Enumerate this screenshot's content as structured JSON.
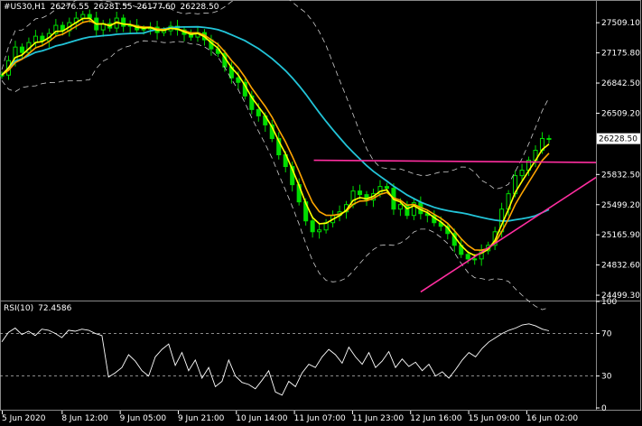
{
  "header": {
    "symbol": "#US30,H1",
    "open": "26276.55",
    "high": "26281.55",
    "low": "26177.60",
    "close": "26228.50"
  },
  "rsi_header": {
    "label": "RSI(10)",
    "value": "72.4586"
  },
  "current_price_label": "26228.50",
  "colors": {
    "background": "#000000",
    "candle": "#00dd00",
    "ema_fast": "#ffff00",
    "ema_slow": "#ffa500",
    "ma_long": "#22c4d8",
    "bands": "#cccccc",
    "trendline": "#ff2ea0",
    "rsi_line": "#ffffff",
    "axis": "#ffffff"
  },
  "chart_data": [
    {
      "type": "line",
      "title": "",
      "xlabel": "",
      "ylabel": "",
      "x_tick_labels": [
        "5 Jun 2020",
        "8 Jun 12:00",
        "9 Jun 05:00",
        "9 Jun 21:00",
        "10 Jun 14:00",
        "11 Jun 07:00",
        "11 Jun 23:00",
        "12 Jun 16:00",
        "15 Jun 09:00",
        "16 Jun 02:00"
      ],
      "y_tick_labels": [
        "27509.10",
        "27175.80",
        "26842.50",
        "26509.20",
        "25832.50",
        "25499.20",
        "25165.90",
        "24832.60",
        "24499.30"
      ],
      "ylim": [
        24450,
        27720
      ],
      "x_count": 140,
      "series": [
        {
          "kind": "price_close",
          "values": [
            26930,
            27090,
            27240,
            27180,
            27290,
            27360,
            27310,
            27390,
            27480,
            27420,
            27510,
            27560,
            27600,
            27560,
            27430,
            27500,
            27450,
            27560,
            27470,
            27480,
            27430,
            27440,
            27460,
            27400,
            27420,
            27470,
            27430,
            27380,
            27350,
            27400,
            27320,
            27220,
            27170,
            27020,
            26900,
            26850,
            26700,
            26550,
            26480,
            26380,
            26230,
            26050,
            25920,
            25720,
            25530,
            25320,
            25200,
            25220,
            25300,
            25380,
            25420,
            25500,
            25650,
            25610,
            25550,
            25620,
            25700,
            25680,
            25450,
            25500,
            25380,
            25520,
            25400,
            25380,
            25300,
            25260,
            25180,
            25050,
            24950,
            24900,
            24900,
            24990,
            25050,
            25200,
            25450,
            25620,
            25820,
            25880,
            25990,
            26100,
            26230,
            26228.5
          ],
          "x_offset": 0
        }
      ],
      "bands_visible": true,
      "grid": false,
      "trendlines": [
        {
          "name": "horizontal resistance",
          "from": {
            "x": 73,
            "y": 25990
          },
          "to": {
            "x": 139,
            "y": 25965
          }
        },
        {
          "name": "rising support",
          "from": {
            "x": 98,
            "y": 24535
          },
          "to": {
            "x": 139,
            "y": 25800
          }
        }
      ]
    },
    {
      "type": "line",
      "title": "",
      "ylabel": "",
      "ylim": [
        0,
        100
      ],
      "y_tick_labels": [
        "100",
        "70",
        "30",
        "0"
      ],
      "levels": [
        70,
        30
      ],
      "series": [
        {
          "name": "RSI(10)",
          "values": [
            62,
            71,
            75,
            69,
            72,
            68,
            74,
            73,
            70,
            66,
            73,
            72,
            74,
            73,
            70,
            68,
            29,
            33,
            38,
            50,
            44,
            35,
            30,
            48,
            55,
            60,
            40,
            52,
            35,
            45,
            28,
            38,
            20,
            25,
            45,
            30,
            24,
            22,
            18,
            26,
            35,
            15,
            12,
            25,
            20,
            33,
            41,
            38,
            48,
            55,
            50,
            42,
            57,
            48,
            41,
            52,
            38,
            44,
            53,
            38,
            46,
            39,
            43,
            35,
            41,
            30,
            34,
            28,
            36,
            45,
            52,
            48,
            56,
            62,
            66,
            70,
            73,
            75,
            78,
            79,
            77,
            74,
            72.4586
          ]
        }
      ]
    }
  ]
}
